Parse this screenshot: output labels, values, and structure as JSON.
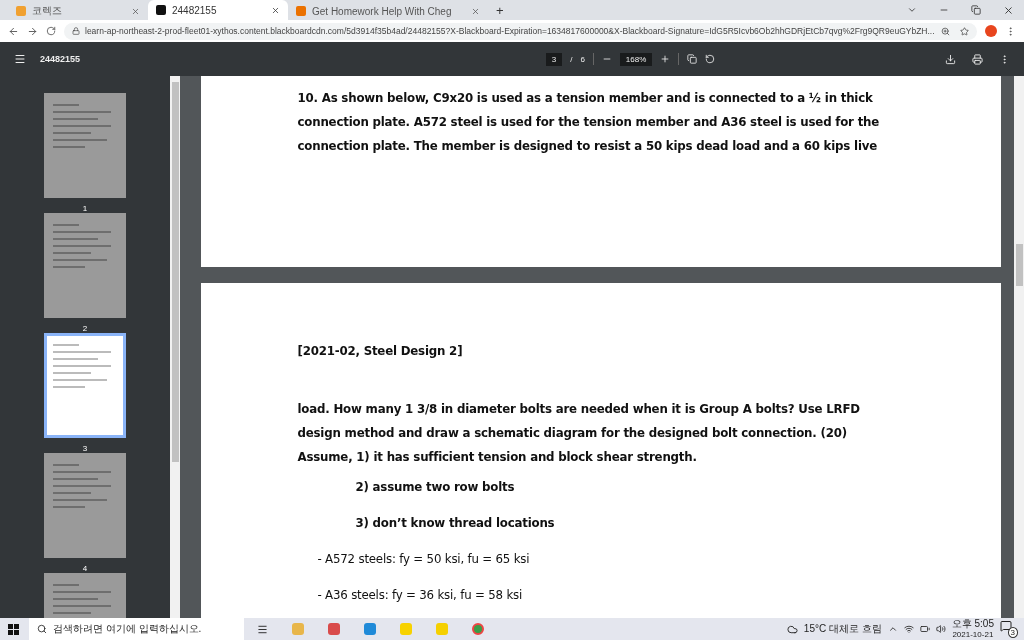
{
  "browser": {
    "tabs": [
      {
        "title": "코렉즈",
        "selected": false,
        "kind": "pencil"
      },
      {
        "title": "24482155",
        "selected": true,
        "kind": "bb"
      },
      {
        "title": "Get Homework Help With Cheg",
        "selected": false,
        "kind": "chegg"
      }
    ],
    "new_tab": "+",
    "address": "learn-ap-northeast-2-prod-fleet01-xythos.content.blackboardcdn.com/5d3914f35b4ad/24482155?X-Blackboard-Expiration=1634817600000&X-Blackboard-Signature=IdG5R5Icvb6Ob2hhGDRjEtCb7qvg%2Frg9QR9euGYbZH..."
  },
  "pdf_toolbar": {
    "title": "24482155",
    "page": "3",
    "page_sep": "/",
    "total": "6",
    "zoom": "168%"
  },
  "thumbnails": [
    {
      "number": "1",
      "selected": false
    },
    {
      "number": "2",
      "selected": false
    },
    {
      "number": "3",
      "selected": true
    },
    {
      "number": "4",
      "selected": false
    },
    {
      "selected": false
    }
  ],
  "pages": [
    {
      "lines": [
        "10. As shown below, C9x20 is used as a tension member and is connected to a ½ in thick",
        "connection plate. A572 steel is used for the tension member and A36 steel is used for the",
        "connection plate. The member is designed to resist a 50 kips dead load and a 60 kips live"
      ]
    },
    {
      "header": "[2021-02, Steel Design 2]",
      "lines": [
        "load. How many 1 3/8 in diameter bolts are needed when it is Group A bolts? Use LRFD",
        "design method and draw a schematic diagram for the designed bolt connection. (20)",
        "Assume, 1) it has sufficient tension and block shear strength."
      ],
      "items": [
        {
          "text": "2) assume two row bolts",
          "kind": "assumption"
        },
        {
          "text": "3) don’t know thread locations",
          "kind": "assumption"
        },
        {
          "text": "- A572 steels: fy = 50 ksi, fu = 65 ksi",
          "kind": "property"
        },
        {
          "text": "- A36 steels: fy = 36 ksi, fu = 58 ksi",
          "kind": "property"
        }
      ]
    }
  ],
  "taskbar": {
    "search_placeholder": "검색하려면 여기에 입력하십시오.",
    "weather": "15°C 대체로 흐림",
    "time": "오후 5:05",
    "date": "2021-10-21",
    "notifications": "3"
  }
}
